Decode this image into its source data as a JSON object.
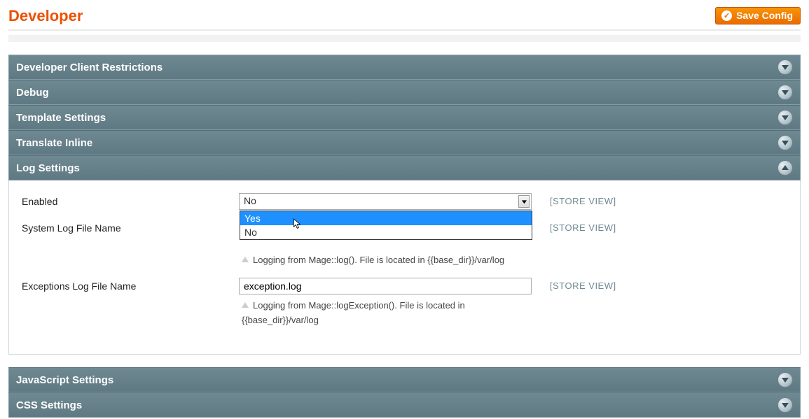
{
  "page": {
    "title": "Developer",
    "save_button": "Save Config"
  },
  "sections": [
    {
      "title": "Developer Client Restrictions",
      "open": false
    },
    {
      "title": "Debug",
      "open": false
    },
    {
      "title": "Template Settings",
      "open": false
    },
    {
      "title": "Translate Inline",
      "open": false
    },
    {
      "title": "Log Settings",
      "open": true
    },
    {
      "title": "JavaScript Settings",
      "open": false
    },
    {
      "title": "CSS Settings",
      "open": false
    }
  ],
  "scope_text": "[STORE VIEW]",
  "log_settings": {
    "enabled": {
      "label": "Enabled",
      "value": "No",
      "options": [
        "Yes",
        "No"
      ],
      "highlighted_index": 0
    },
    "system_log": {
      "label": "System Log File Name",
      "hint": "Logging from Mage::log(). File is located in {{base_dir}}/var/log"
    },
    "exception_log": {
      "label": "Exceptions Log File Name",
      "value": "exception.log",
      "hint": "Logging from Mage::logException(). File is located in {{base_dir}}/var/log"
    }
  }
}
